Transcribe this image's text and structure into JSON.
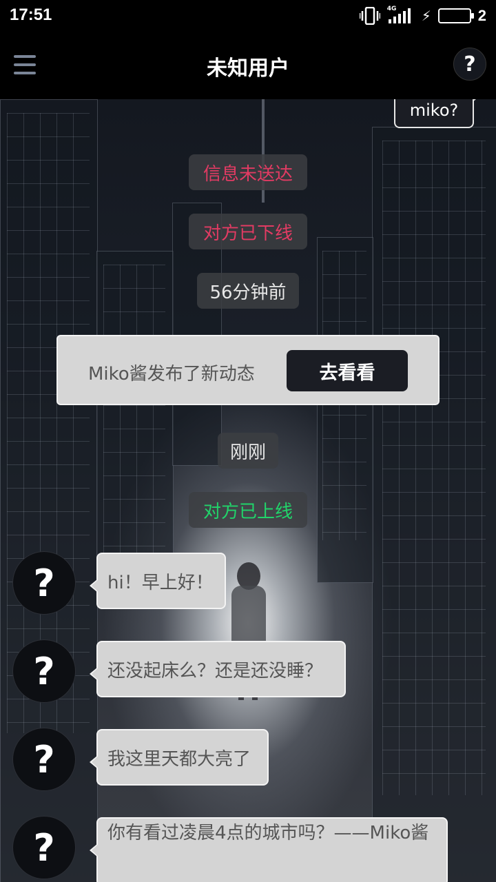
{
  "status_bar": {
    "time": "17:51",
    "network": "4G",
    "battery_level": "2"
  },
  "header": {
    "title": "未知用户",
    "help_label": "?"
  },
  "chat": {
    "sent_message": "miko?",
    "system_notices": {
      "undelivered": "信息未送达",
      "went_offline": "对方已下线",
      "time_ago": "56分钟前",
      "just_now": "刚刚",
      "came_online": "对方已上线"
    },
    "notification": {
      "text": "Miko酱发布了新动态",
      "button": "去看看"
    },
    "messages": [
      {
        "avatar": "?",
        "text": "hi！早上好！"
      },
      {
        "avatar": "?",
        "text": "还没起床么？还是还没睡？"
      },
      {
        "avatar": "?",
        "text": "我这里天都大亮了"
      },
      {
        "avatar": "?",
        "text": "你有看过凌晨4点的城市吗？——Miko酱"
      }
    ]
  },
  "colors": {
    "red_notice": "#e23b63",
    "green_notice": "#21d46a",
    "bubble_bg": "#d4d4d4",
    "button_bg": "#1b1d24"
  }
}
